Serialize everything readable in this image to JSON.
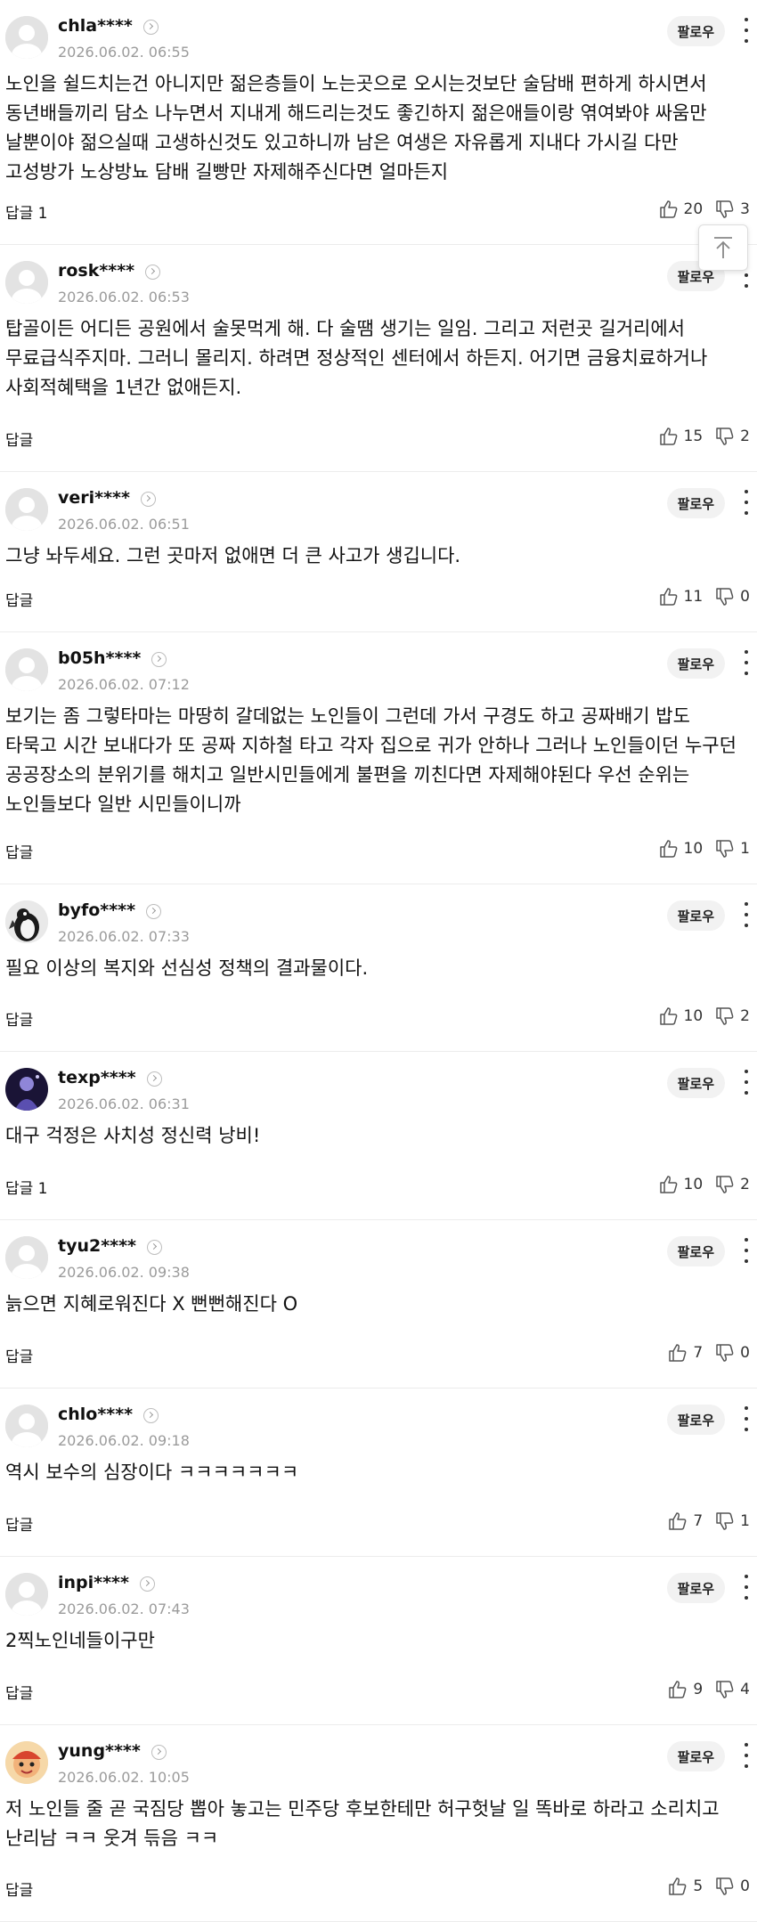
{
  "comments": [
    {
      "username": "chla****",
      "timestamp": "2026.06.02. 06:55",
      "follow_label": "팔로우",
      "text": "노인을 쉴드치는건 아니지만 젊은층들이 노는곳으로 오시는것보단 술담배 편하게 하시면서 동년배들끼리 담소 나누면서 지내게 해드리는것도 좋긴하지 젊은애들이랑 엮여봐야 싸움만 날뿐이야 젊으실때 고생하신것도 있고하니까 남은 여생은 자유롭게 지내다 가시길 다만 고성방가 노상방뇨 담배 길빵만 자제해주신다면 얼마든지",
      "reply_label": "답글 1",
      "likes": "20",
      "dislikes": "3",
      "avatar": "default"
    },
    {
      "username": "rosk****",
      "timestamp": "2026.06.02. 06:53",
      "follow_label": "팔로우",
      "text": "탑골이든 어디든 공원에서 술못먹게 해. 다 술땜 생기는 일임. 그리고 저런곳 길거리에서 무료급식주지마. 그러니 몰리지. 하려면 정상적인 센터에서 하든지. 어기면 금융치료하거나 사회적혜택을 1년간 없애든지.",
      "reply_label": "답글",
      "likes": "15",
      "dislikes": "2",
      "avatar": "default"
    },
    {
      "username": "veri****",
      "timestamp": "2026.06.02. 06:51",
      "follow_label": "팔로우",
      "text": "그냥 놔두세요. 그런 곳마저 없애면 더 큰 사고가 생깁니다.",
      "reply_label": "답글",
      "likes": "11",
      "dislikes": "0",
      "avatar": "default"
    },
    {
      "username": "b05h****",
      "timestamp": "2026.06.02. 07:12",
      "follow_label": "팔로우",
      "text": "보기는 좀 그렇타마는 마땅히 갈데없는 노인들이 그런데 가서 구경도 하고 공짜배기 밥도 타묵고 시간 보내다가 또 공짜 지하철 타고 각자 집으로 귀가 안하나 그러나 노인들이던 누구던 공공장소의 분위기를 해치고 일반시민들에게 불편을 끼친다면 자제해야된다 우선 순위는 노인들보다 일반 시민들이니까",
      "reply_label": "답글",
      "likes": "10",
      "dislikes": "1",
      "avatar": "default"
    },
    {
      "username": "byfo****",
      "timestamp": "2026.06.02. 07:33",
      "follow_label": "팔로우",
      "text": "필요 이상의 복지와 선심성 정책의 결과물이다.",
      "reply_label": "답글",
      "likes": "10",
      "dislikes": "2",
      "avatar": "penguin"
    },
    {
      "username": "texp****",
      "timestamp": "2026.06.02. 06:31",
      "follow_label": "팔로우",
      "text": "대구 걱정은 사치성 정신력 낭비!",
      "reply_label": "답글 1",
      "likes": "10",
      "dislikes": "2",
      "avatar": "dark"
    },
    {
      "username": "tyu2****",
      "timestamp": "2026.06.02. 09:38",
      "follow_label": "팔로우",
      "text": "늙으면 지혜로워진다 X 뻔뻔해진다 O",
      "reply_label": "답글",
      "likes": "7",
      "dislikes": "0",
      "avatar": "default"
    },
    {
      "username": "chlo****",
      "timestamp": "2026.06.02. 09:18",
      "follow_label": "팔로우",
      "text": "역시 보수의 심장이다 ㅋㅋㅋㅋㅋㅋㅋ",
      "reply_label": "답글",
      "likes": "7",
      "dislikes": "1",
      "avatar": "default"
    },
    {
      "username": "inpi****",
      "timestamp": "2026.06.02. 07:43",
      "follow_label": "팔로우",
      "text": "2찍노인네들이구만",
      "reply_label": "답글",
      "likes": "9",
      "dislikes": "4",
      "avatar": "default"
    },
    {
      "username": "yung****",
      "timestamp": "2026.06.02. 10:05",
      "follow_label": "팔로우",
      "text": "저 노인들 줄 곧 국짐당 뽑아 놓고는 민주당 후보한테만 허구헛날 일 똑바로 하라고 소리치고 난리남 ㅋㅋ 웃겨 듞음 ㅋㅋ",
      "reply_label": "답글",
      "likes": "5",
      "dislikes": "0",
      "avatar": "cartoon"
    }
  ],
  "icons": {
    "like": "thumbs-up-icon",
    "dislike": "thumbs-down-icon",
    "more": "more-vertical-icon",
    "scroll_top": "scroll-to-top-icon"
  }
}
